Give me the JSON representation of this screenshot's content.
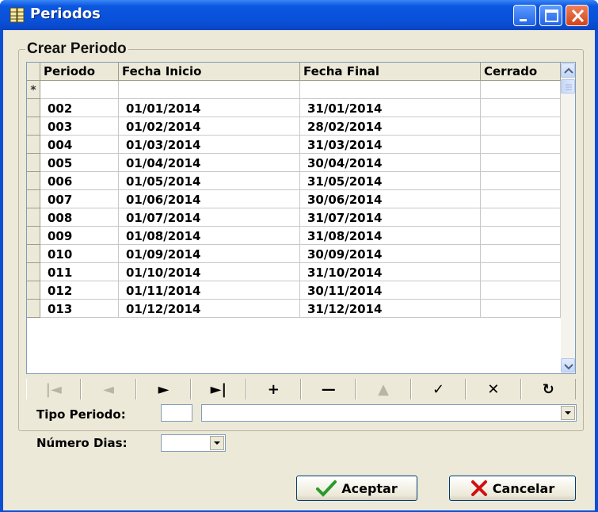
{
  "window": {
    "title": "Periodos",
    "icon": "app-grid-icon"
  },
  "group": {
    "title": "Crear Periodo"
  },
  "grid": {
    "columns": [
      "Periodo",
      "Fecha Inicio",
      "Fecha Final",
      "Cerrado"
    ],
    "new_row_marker": "*",
    "rows": [
      {
        "periodo": "002",
        "inicio": "01/01/2014",
        "final": "31/01/2014",
        "cerrado": ""
      },
      {
        "periodo": "003",
        "inicio": "01/02/2014",
        "final": "28/02/2014",
        "cerrado": ""
      },
      {
        "periodo": "004",
        "inicio": "01/03/2014",
        "final": "31/03/2014",
        "cerrado": ""
      },
      {
        "periodo": "005",
        "inicio": "01/04/2014",
        "final": "30/04/2014",
        "cerrado": ""
      },
      {
        "periodo": "006",
        "inicio": "01/05/2014",
        "final": "31/05/2014",
        "cerrado": ""
      },
      {
        "periodo": "007",
        "inicio": "01/06/2014",
        "final": "30/06/2014",
        "cerrado": ""
      },
      {
        "periodo": "008",
        "inicio": "01/07/2014",
        "final": "31/07/2014",
        "cerrado": ""
      },
      {
        "periodo": "009",
        "inicio": "01/08/2014",
        "final": "31/08/2014",
        "cerrado": ""
      },
      {
        "periodo": "010",
        "inicio": "01/09/2014",
        "final": "30/09/2014",
        "cerrado": ""
      },
      {
        "periodo": "011",
        "inicio": "01/10/2014",
        "final": "31/10/2014",
        "cerrado": ""
      },
      {
        "periodo": "012",
        "inicio": "01/11/2014",
        "final": "30/11/2014",
        "cerrado": ""
      },
      {
        "periodo": "013",
        "inicio": "01/12/2014",
        "final": "31/12/2014",
        "cerrado": ""
      }
    ]
  },
  "navigator": {
    "buttons": [
      {
        "name": "first-record-icon",
        "glyph": "|◄",
        "enabled": false
      },
      {
        "name": "prior-record-icon",
        "glyph": "◄",
        "enabled": false
      },
      {
        "name": "next-record-icon",
        "glyph": "►",
        "enabled": true
      },
      {
        "name": "last-record-icon",
        "glyph": "►|",
        "enabled": true
      },
      {
        "name": "insert-record-icon",
        "glyph": "+",
        "enabled": true
      },
      {
        "name": "delete-record-icon",
        "glyph": "—",
        "enabled": true
      },
      {
        "name": "edit-record-icon",
        "glyph": "▲",
        "enabled": false
      },
      {
        "name": "post-edit-icon",
        "glyph": "✓",
        "enabled": true
      },
      {
        "name": "cancel-edit-icon",
        "glyph": "✕",
        "enabled": true
      },
      {
        "name": "refresh-icon",
        "glyph": "↻",
        "enabled": true
      }
    ]
  },
  "form": {
    "tipo_periodo_label": "Tipo Periodo:",
    "tipo_periodo_code": "",
    "tipo_periodo_value": "",
    "numero_dias_label": "Número Dias:",
    "numero_dias_value": ""
  },
  "buttons": {
    "accept_label": "Aceptar",
    "cancel_label": "Cancelar"
  },
  "colors": {
    "titlebar": "#0a50d8",
    "dialog_bg": "#ece9d8",
    "close_button": "#d2431b",
    "accept_icon": "#2a9a2a",
    "cancel_icon": "#d01010"
  }
}
